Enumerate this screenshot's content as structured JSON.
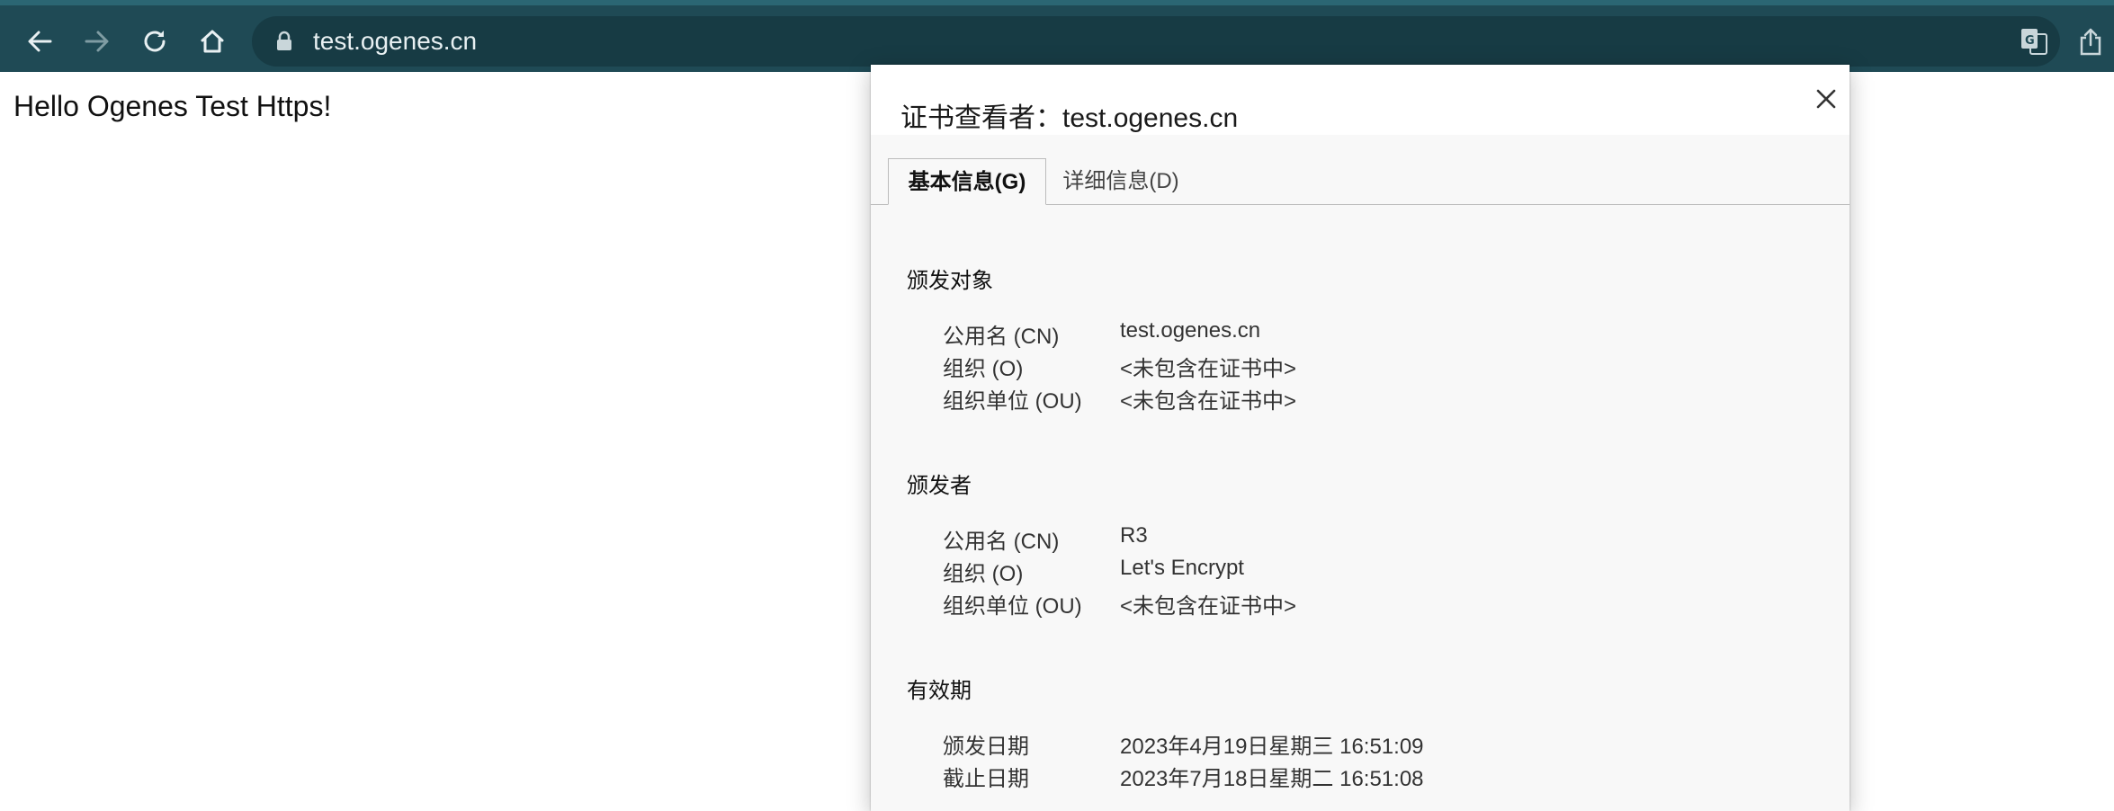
{
  "browser": {
    "url": "test.ogenes.cn",
    "icons": {
      "back": "arrow-left-icon",
      "forward": "arrow-right-icon",
      "reload": "reload-icon",
      "home": "home-icon",
      "lock": "lock-icon",
      "translate": "translate-icon",
      "share": "share-icon"
    }
  },
  "page": {
    "body_text": "Hello Ogenes Test Https!"
  },
  "dialog": {
    "title": "证书查看者：test.ogenes.cn",
    "tabs": [
      {
        "label": "基本信息(G)",
        "active": true
      },
      {
        "label": "详细信息(D)",
        "active": false
      }
    ],
    "issued_to": {
      "heading": "颁发对象",
      "rows": [
        {
          "label": "公用名 (CN)",
          "value": "test.ogenes.cn"
        },
        {
          "label": "组织 (O)",
          "value": "<未包含在证书中>"
        },
        {
          "label": "组织单位 (OU)",
          "value": "<未包含在证书中>"
        }
      ]
    },
    "issued_by": {
      "heading": "颁发者",
      "rows": [
        {
          "label": "公用名 (CN)",
          "value": "R3"
        },
        {
          "label": "组织 (O)",
          "value": "Let's Encrypt"
        },
        {
          "label": "组织单位 (OU)",
          "value": "<未包含在证书中>"
        }
      ]
    },
    "validity": {
      "heading": "有效期",
      "rows": [
        {
          "label": "颁发日期",
          "value": "2023年4月19日星期三 16:51:09"
        },
        {
          "label": "截止日期",
          "value": "2023年7月18日星期二 16:51:08"
        }
      ]
    }
  },
  "colors": {
    "toolbar": "#1f4a55",
    "omnibox": "#173b44",
    "dialog_bg": "#f8f8f8"
  }
}
